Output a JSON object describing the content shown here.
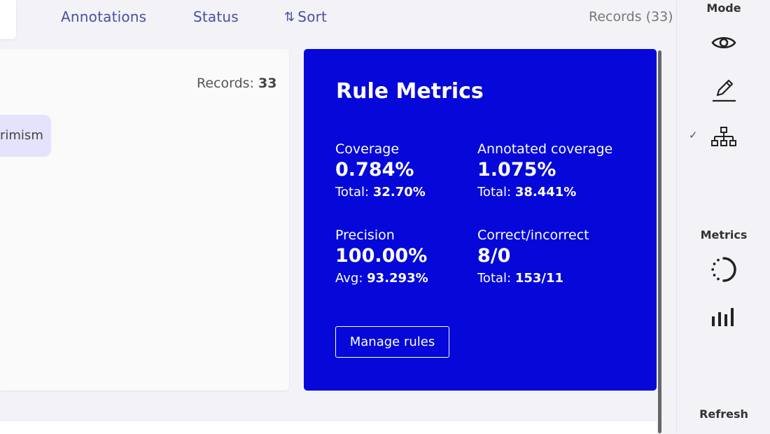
{
  "toolbar": {
    "annotations_label": "Annotations",
    "status_label": "Status",
    "sort_label": "Sort",
    "records_label": "Records (33)"
  },
  "card": {
    "records_prefix": "Records:",
    "records_value": "33",
    "rule_chip_text": "rimism"
  },
  "metrics": {
    "title": "Rule Metrics",
    "coverage": {
      "label": "Coverage",
      "value": "0.784%",
      "sub_prefix": "Total:",
      "sub_value": "32.70%"
    },
    "annotated_coverage": {
      "label": "Annotated coverage",
      "value": "1.075%",
      "sub_prefix": "Total:",
      "sub_value": "38.441%"
    },
    "precision": {
      "label": "Precision",
      "value": "100.00%",
      "sub_prefix": "Avg:",
      "sub_value": "93.293%"
    },
    "correct_incorrect": {
      "label": "Correct/incorrect",
      "value": "8/0",
      "sub_prefix": "Total:",
      "sub_value": "153/11"
    },
    "manage_button": "Manage rules",
    "panel_color": "#0508d8"
  },
  "sidebar": {
    "mode_heading": "Mode",
    "mode_icons": [
      "eye-icon",
      "pencil-icon",
      "hierarchy-icon"
    ],
    "selected_mode": "hierarchy-icon",
    "check_mark": "✓",
    "metrics_heading": "Metrics",
    "metrics_icons": [
      "progress-circle-icon",
      "bar-chart-icon"
    ],
    "refresh_heading": "Refresh"
  }
}
